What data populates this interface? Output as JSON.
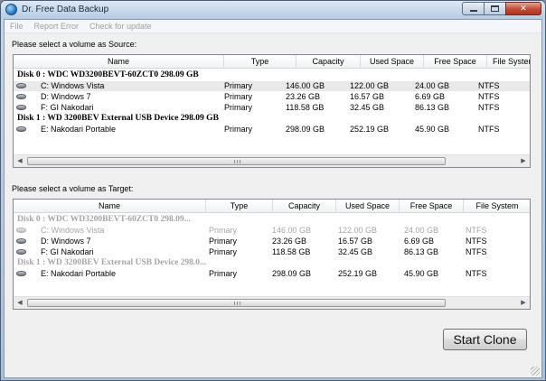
{
  "window": {
    "title": "Dr. Free Data Backup",
    "caption_close": "✕"
  },
  "menu": [
    "File",
    "Report Error",
    "Check for update"
  ],
  "source": {
    "label": "Please select a volume as Source:",
    "columns": [
      "Name",
      "Type",
      "Capacity",
      "Used Space",
      "Free Space",
      "File System"
    ],
    "rows": [
      {
        "kind": "disk",
        "label": "Disk 0 : WDC WD3200BEVT-60ZCT0  298.09 GB"
      },
      {
        "kind": "vol",
        "name": "C: Windows Vista",
        "type": "Primary",
        "capacity": "146.00 GB",
        "used": "122.00 GB",
        "free": "24.00 GB",
        "fs": "NTFS",
        "selected": true
      },
      {
        "kind": "vol",
        "name": "D: Windows 7",
        "type": "Primary",
        "capacity": "23.26 GB",
        "used": "16.57 GB",
        "free": "6.69 GB",
        "fs": "NTFS"
      },
      {
        "kind": "vol",
        "name": "F: GI Nakodari",
        "type": "Primary",
        "capacity": "118.58 GB",
        "used": "32.45 GB",
        "free": "86.13 GB",
        "fs": "NTFS"
      },
      {
        "kind": "disk",
        "label": "Disk 1 : WD 3200BEV External USB Device  298.09 GB"
      },
      {
        "kind": "vol",
        "name": "E: Nakodari Portable",
        "type": "Primary",
        "capacity": "298.09 GB",
        "used": "252.19 GB",
        "free": "45.90 GB",
        "fs": "NTFS"
      }
    ]
  },
  "target": {
    "label": "Please select a volume as Target:",
    "columns": [
      "Name",
      "Type",
      "Capacity",
      "Used Space",
      "Free Space",
      "File System"
    ],
    "rows": [
      {
        "kind": "disk",
        "label": "Disk 0 : WDC WD3200BEVT-60ZCT0  298.09...",
        "dim": true
      },
      {
        "kind": "vol",
        "name": "C: Windows Vista",
        "type": "Primary",
        "capacity": "146.00 GB",
        "used": "122.00 GB",
        "free": "24.00 GB",
        "fs": "NTFS",
        "dim": true
      },
      {
        "kind": "vol",
        "name": "D: Windows 7",
        "type": "Primary",
        "capacity": "23.26 GB",
        "used": "16.57 GB",
        "free": "6.69 GB",
        "fs": "NTFS"
      },
      {
        "kind": "vol",
        "name": "F: GI Nakodari",
        "type": "Primary",
        "capacity": "118.58 GB",
        "used": "32.45 GB",
        "free": "86.13 GB",
        "fs": "NTFS"
      },
      {
        "kind": "disk",
        "label": "Disk 1 : WD 3200BEV External USB Device  298.0...",
        "dim": true
      },
      {
        "kind": "vol",
        "name": "E: Nakodari Portable",
        "type": "Primary",
        "capacity": "298.09 GB",
        "used": "252.19 GB",
        "free": "45.90 GB",
        "fs": "NTFS"
      }
    ]
  },
  "actions": {
    "start_clone": "Start Clone"
  }
}
